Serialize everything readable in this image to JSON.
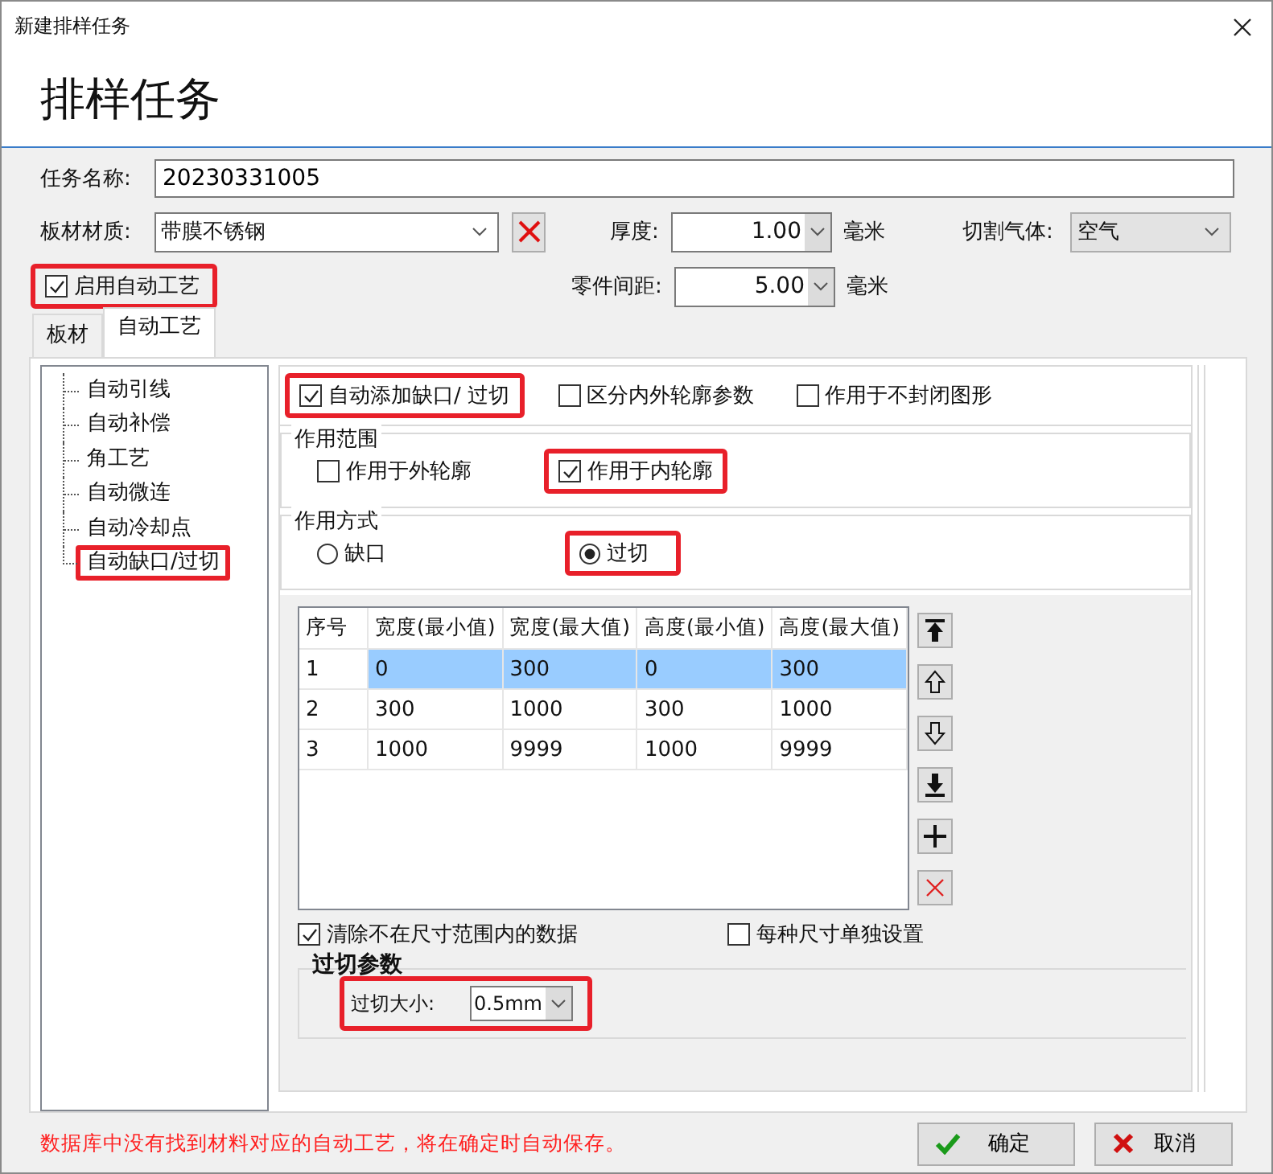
{
  "window": {
    "title": "新建排样任务"
  },
  "header": {
    "title": "排样任务"
  },
  "form": {
    "task_name": {
      "label": "任务名称:",
      "value": "20230331005"
    },
    "material": {
      "label": "板材材质:",
      "value": "带膜不锈钢"
    },
    "thickness": {
      "label": "厚度:",
      "value": "1.00",
      "unit": "毫米"
    },
    "gas": {
      "label": "切割气体:",
      "value": "空气"
    },
    "spacing": {
      "label": "零件间距:",
      "value": "5.00",
      "unit": "毫米"
    },
    "auto_process": {
      "label": "启用自动工艺",
      "checked": true,
      "highlighted": true
    }
  },
  "tabs": [
    {
      "label": "板材",
      "selected": false
    },
    {
      "label": "自动工艺",
      "selected": true
    }
  ],
  "tree": [
    {
      "label": "自动引线",
      "highlighted": false
    },
    {
      "label": "自动补偿",
      "highlighted": false
    },
    {
      "label": "角工艺",
      "highlighted": false
    },
    {
      "label": "自动微连",
      "highlighted": false
    },
    {
      "label": "自动冷却点",
      "highlighted": false
    },
    {
      "label": "自动缺口/过切",
      "highlighted": true
    }
  ],
  "options": [
    {
      "label": "自动添加缺口/ 过切",
      "checked": true,
      "highlighted": true
    },
    {
      "label": "区分内外轮廓参数",
      "checked": false,
      "highlighted": false
    },
    {
      "label": "作用于不封闭图形",
      "checked": false,
      "highlighted": false
    }
  ],
  "scope": {
    "title": "作用范围",
    "options": [
      {
        "label": "作用于外轮廓",
        "checked": false,
        "highlighted": false
      },
      {
        "label": "作用于内轮廓",
        "checked": true,
        "highlighted": true
      }
    ]
  },
  "mode": {
    "title": "作用方式",
    "options": [
      {
        "label": "缺口",
        "selected": false,
        "highlighted": false
      },
      {
        "label": "过切",
        "selected": true,
        "highlighted": true
      }
    ]
  },
  "table": {
    "columns": [
      "序号",
      "宽度(最小值)",
      "宽度(最大值)",
      "高度(最小值)",
      "高度(最大值)"
    ],
    "rows": [
      {
        "cells": [
          "1",
          "0",
          "300",
          "0",
          "300"
        ],
        "selected": true
      },
      {
        "cells": [
          "2",
          "300",
          "1000",
          "300",
          "1000"
        ],
        "selected": false
      },
      {
        "cells": [
          "3",
          "1000",
          "9999",
          "1000",
          "9999"
        ],
        "selected": false
      }
    ]
  },
  "bottom_options": [
    {
      "label": "清除不在尺寸范围内的数据",
      "checked": true
    },
    {
      "label": "每种尺寸单独设置",
      "checked": false
    }
  ],
  "overcut": {
    "title": "过切参数",
    "label": "过切大小:",
    "value": "0.5mm",
    "highlighted": true
  },
  "status_message": "数据库中没有找到材料对应的自动工艺，将在确定时自动保存。",
  "buttons": [
    {
      "label": "确定",
      "kind": "ok"
    },
    {
      "label": "取消",
      "kind": "cancel"
    }
  ]
}
